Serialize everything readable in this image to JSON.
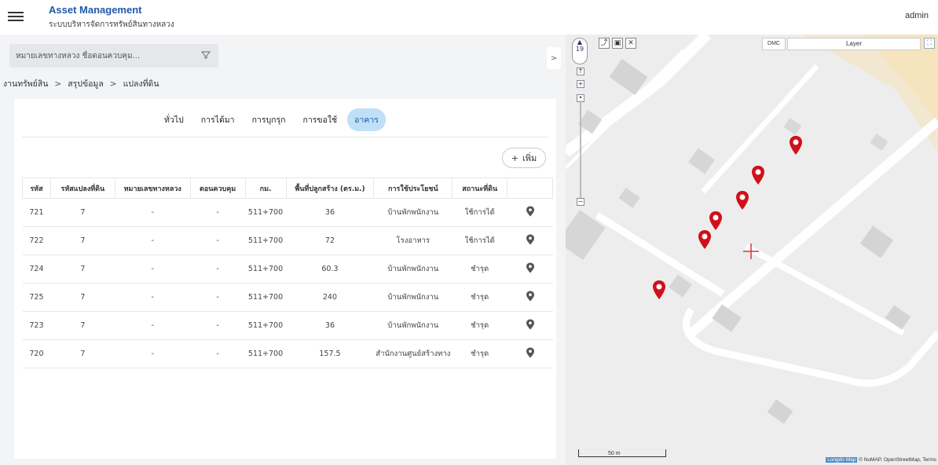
{
  "header": {
    "app_title": "Asset Management",
    "app_subtitle": "ระบบบริหารจัดการทรัพย์สินทางหลวง",
    "user": "admin"
  },
  "search": {
    "placeholder": "หมายเลขทางหลวง ชื่อตอนควบคุม..."
  },
  "breadcrumb": [
    "งานทรัพย์สิน",
    "สรุปข้อมูล",
    "แปลงที่ดิน"
  ],
  "tabs": [
    {
      "label": "ทั่วไป",
      "active": false
    },
    {
      "label": "การได้มา",
      "active": false
    },
    {
      "label": "การบุกรุก",
      "active": false
    },
    {
      "label": "การขอใช้",
      "active": false
    },
    {
      "label": "อาคาร",
      "active": true
    }
  ],
  "add_button": {
    "icon": "+",
    "label": "เพิ่ม"
  },
  "table": {
    "headers": [
      "รหัส",
      "รหัสแปลงที่ดิน",
      "หมายเลขทางหลวง",
      "ตอนควบคุม",
      "กม.",
      "พื้นที่ปลูกสร้าง (ตร.ม.)",
      "การใช้ประโยชน์",
      "สถานะที่ดิน",
      ""
    ],
    "rows": [
      {
        "id": "721",
        "parcel": "7",
        "highway": "-",
        "control": "-",
        "km": "511+700",
        "area": "36",
        "usage": "บ้านพักพนักงาน",
        "status": "ใช้การได้"
      },
      {
        "id": "722",
        "parcel": "7",
        "highway": "-",
        "control": "-",
        "km": "511+700",
        "area": "72",
        "usage": "โรงอาหาร",
        "status": "ใช้การได้"
      },
      {
        "id": "724",
        "parcel": "7",
        "highway": "-",
        "control": "-",
        "km": "511+700",
        "area": "60.3",
        "usage": "บ้านพักพนักงาน",
        "status": "ชำรุด"
      },
      {
        "id": "725",
        "parcel": "7",
        "highway": "-",
        "control": "-",
        "km": "511+700",
        "area": "240",
        "usage": "บ้านพักพนักงาน",
        "status": "ชำรุด"
      },
      {
        "id": "723",
        "parcel": "7",
        "highway": "-",
        "control": "-",
        "km": "511+700",
        "area": "36",
        "usage": "บ้านพักพนักงาน",
        "status": "ชำรุด"
      },
      {
        "id": "720",
        "parcel": "7",
        "highway": "-",
        "control": "-",
        "km": "511+700",
        "area": "157.5",
        "usage": "สำนักงานศูนย์สร้างทาง",
        "status": "ชำรุด"
      }
    ]
  },
  "map": {
    "zoom_level": "19",
    "dmc_label": "DMC",
    "layer_label": "Layer",
    "scale_label": "50 m",
    "attribution_brand": "Longdo Map",
    "attribution_text": "© NuMAP, OpenStreetMap, Terms",
    "marker_color": "#d0101b"
  },
  "icons": {
    "menu": "menu-icon",
    "filter": "filter-icon",
    "pin": "map-pin-icon",
    "collapse": "chevron-right-icon"
  }
}
